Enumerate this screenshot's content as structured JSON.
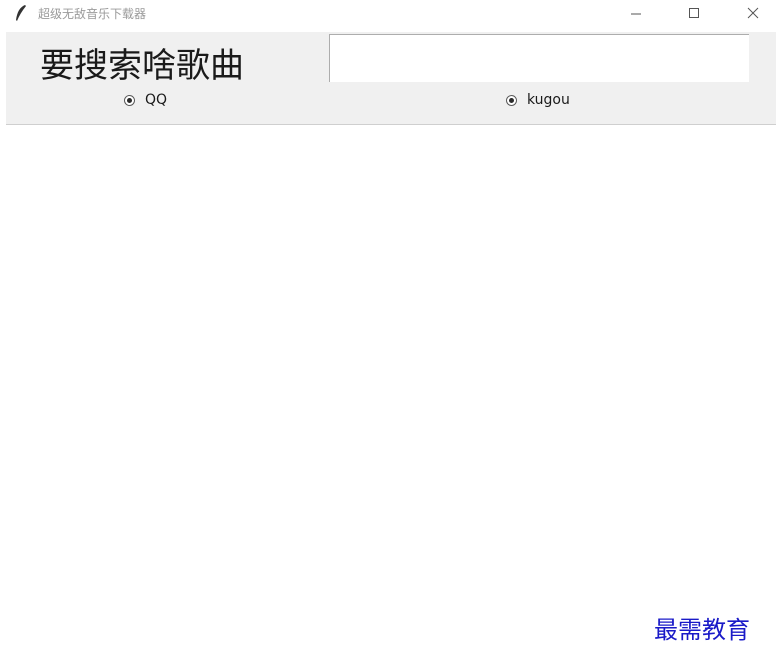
{
  "window": {
    "title": "超级无敌音乐下载器",
    "icon": "feather-icon"
  },
  "search": {
    "label": "要搜索啥歌曲",
    "value": "",
    "placeholder": ""
  },
  "sources": [
    {
      "label": "QQ",
      "selected": true
    },
    {
      "label": "kugou",
      "selected": true
    }
  ],
  "watermark": "最需教育"
}
